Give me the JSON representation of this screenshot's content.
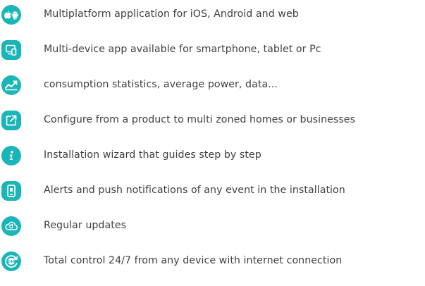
{
  "accent_color": "#1ab5b8",
  "features": [
    {
      "icon": "apple-android-icon",
      "text": "Multiplatform application for iOS, Android and web"
    },
    {
      "icon": "multi-device-icon",
      "text": "Multi-device app available for smartphone, tablet or Pc"
    },
    {
      "icon": "stats-trend-icon",
      "text": "consumption statistics, average power, data..."
    },
    {
      "icon": "external-link-square-icon",
      "text": "Configure from a product to multi zoned homes or businesses"
    },
    {
      "icon": "info-icon",
      "text": "Installation wizard that guides step by step"
    },
    {
      "icon": "phone-notification-icon",
      "text": "Alerts and push notifications of any event in the installation"
    },
    {
      "icon": "cloud-refresh-icon",
      "text": "Regular updates"
    },
    {
      "icon": "clock-24h-icon",
      "text": "Total control 24/7 from any device with internet connection"
    }
  ]
}
